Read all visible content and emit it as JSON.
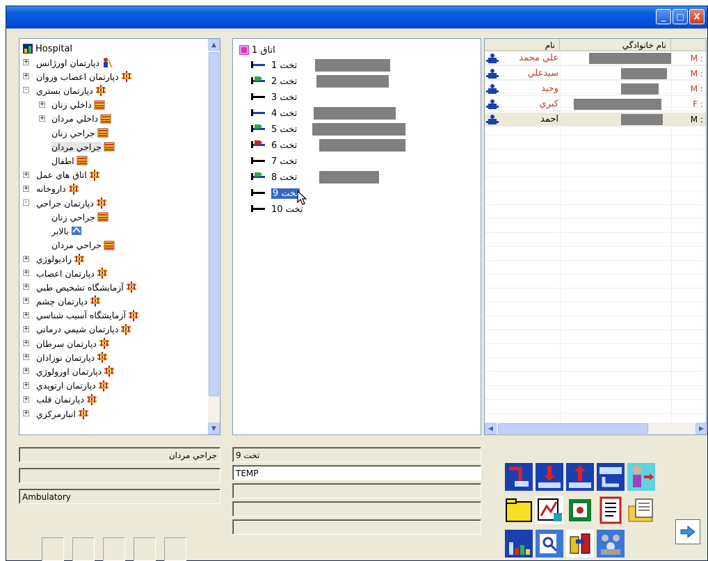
{
  "window": {
    "minimize": "_",
    "maximize": "□",
    "close": "X"
  },
  "tree": {
    "root": "Hospital",
    "items": [
      {
        "label": "دپارتمان  اورژانس"
      },
      {
        "label": "دپارتمان اعصاب وروان"
      },
      {
        "label": "دپارتمان بستري"
      },
      {
        "label": "داخلي زنان"
      },
      {
        "label": "داخلي مردان"
      },
      {
        "label": "جراحي زنان"
      },
      {
        "label": "جراحي مردان"
      },
      {
        "label": "اطفال"
      },
      {
        "label": "اتاق هاي عمل"
      },
      {
        "label": "داروخانه"
      },
      {
        "label": "دپارتمان جراحي"
      },
      {
        "label": "جراحي زنان"
      },
      {
        "label": "بالابر"
      },
      {
        "label": "جراحي مردان"
      },
      {
        "label": "راديولوژي"
      },
      {
        "label": "دپارتمان اعصاب"
      },
      {
        "label": "آزمايشگاه تشخيص طبي"
      },
      {
        "label": "دپارتمان چشم"
      },
      {
        "label": "آزمايشگاه آسيب شناسي"
      },
      {
        "label": "دپارتمان شيمي درماني"
      },
      {
        "label": "دپارتمان سرطان"
      },
      {
        "label": "دپارتمان نوزادان"
      },
      {
        "label": "دپارتمان اورولوژي"
      },
      {
        "label": "دپارتمان ارتوپدي"
      },
      {
        "label": "دپارتمان قلب"
      },
      {
        "label": "انبارمركزي"
      }
    ]
  },
  "beds": {
    "room": "اتاق 1",
    "items": [
      {
        "label": "تخت 1"
      },
      {
        "label": "تخت 2"
      },
      {
        "label": "تخت 3"
      },
      {
        "label": "تخت 4"
      },
      {
        "label": "تخت 5"
      },
      {
        "label": "تخت 6"
      },
      {
        "label": "تخت 7"
      },
      {
        "label": "تخت 8"
      },
      {
        "label": "تخت 9"
      },
      {
        "label": "تخت 10"
      }
    ]
  },
  "patients": {
    "columns": [
      "نام",
      "نام خانوادگي",
      ""
    ],
    "rows": [
      {
        "name": "علي محمد",
        "gender": "M :",
        "color": "#c0392b"
      },
      {
        "name": "سيدعلي",
        "gender": "M :",
        "color": "#c0392b"
      },
      {
        "name": "وحيد",
        "gender": "M :",
        "color": "#c0392b"
      },
      {
        "name": "كبري",
        "gender": "F :",
        "color": "#c0392b"
      },
      {
        "name": "احمد",
        "gender": "M :",
        "color": "#000000"
      }
    ]
  },
  "info_left": {
    "ward": "جراحي مردان",
    "line2": "",
    "type": "Ambulatory"
  },
  "info_mid": {
    "bed": "تخت 9",
    "code": "TEMP",
    "line3": "",
    "line4": "",
    "line5": ""
  }
}
